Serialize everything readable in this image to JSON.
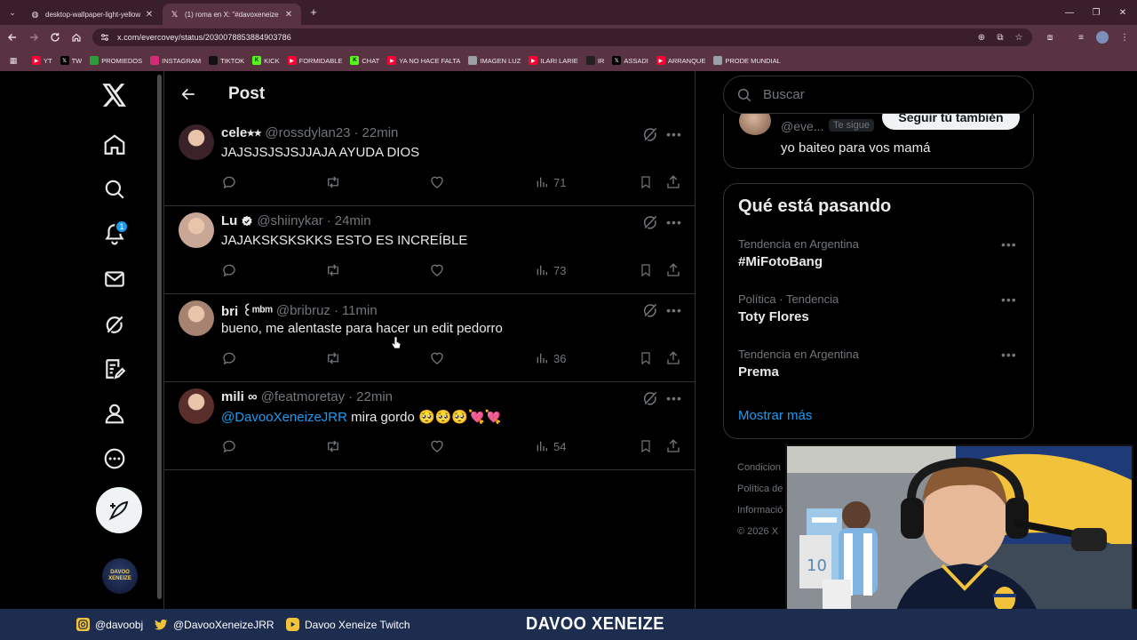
{
  "browser": {
    "tabs": [
      {
        "title": "desktop-wallpaper-light-yellow",
        "active": false
      },
      {
        "title": "(1) roma en X: \"#davoxeneize",
        "active": true
      }
    ],
    "url": "x.com/evercovey/status/2030078853884903786",
    "bookmarks": [
      {
        "label": "YT",
        "icon": "youtube-icon",
        "color": "#ff0033"
      },
      {
        "label": "TW",
        "icon": "x-icon",
        "color": "#000000"
      },
      {
        "label": "PROMIEDOS",
        "icon": "promiedos-icon",
        "color": "#2e9b3a"
      },
      {
        "label": "INSTAGRAM",
        "icon": "instagram-icon",
        "color": "#d62976"
      },
      {
        "label": "TIKTOK",
        "icon": "tiktok-icon",
        "color": "#111111"
      },
      {
        "label": "KICK",
        "icon": "kick-icon",
        "color": "#53fc18"
      },
      {
        "label": "FORMIDABLE",
        "icon": "youtube-icon",
        "color": "#ff0033"
      },
      {
        "label": "CHAT",
        "icon": "kick-icon",
        "color": "#53fc18"
      },
      {
        "label": "YA NO HACE FALTA",
        "icon": "youtube-icon",
        "color": "#ff0033"
      },
      {
        "label": "IMAGEN LUZ",
        "icon": "globe-icon",
        "color": "#9aa0a6"
      },
      {
        "label": "ILARI LARIE",
        "icon": "youtube-icon",
        "color": "#ff0033"
      },
      {
        "label": "IR",
        "icon": "mk-icon",
        "color": "#222222"
      },
      {
        "label": "ASSADI",
        "icon": "x-icon",
        "color": "#000000"
      },
      {
        "label": "ARRANQUE",
        "icon": "youtube-icon",
        "color": "#ff0033"
      },
      {
        "label": "PRODE MUNDIAL",
        "icon": "globe-icon",
        "color": "#9aa0a6"
      }
    ]
  },
  "header": {
    "title": "Post"
  },
  "nav": {
    "notification_count": "1"
  },
  "replies": [
    {
      "name": "cele⭑⭒",
      "handle": "@rossdylan23",
      "time": "22min",
      "text": "JAJSJSJSJSJJAJA AYUDA DIOS",
      "mention": "",
      "views": "71",
      "verified": false,
      "avatar_color": "#3a2228"
    },
    {
      "name": "Lu",
      "handle": "@shiinykar",
      "time": "24min",
      "text": "JAJAKSKSKSKKS ESTO ES INCREÍBLE",
      "mention": "",
      "views": "73",
      "verified": true,
      "avatar_color": "#c9a796"
    },
    {
      "name": "bri ꒰ᵐᵇᵐ",
      "handle": "@bribruz",
      "time": "11min",
      "text": "bueno, me alentaste para hacer un edit pedorro",
      "mention": "",
      "views": "36",
      "verified": false,
      "avatar_color": "#a58370"
    },
    {
      "name": "mili ∞",
      "handle": "@featmoretay",
      "time": "22min",
      "text": " mira gordo 🥺🥺🥺💘💘",
      "mention": "@DavooXeneizeJRR",
      "views": "54",
      "verified": false,
      "avatar_color": "#5a2f2b"
    }
  ],
  "sidebar": {
    "search_placeholder": "Buscar",
    "who_to_follow": {
      "handle": "@eve...",
      "badge": "Te sigue",
      "button": "Seguir tú también",
      "bio": "yo baiteo para vos mamá"
    },
    "trends_title": "Qué está pasando",
    "trends": [
      {
        "context": "Tendencia en Argentina",
        "name": "#MiFotoBang"
      },
      {
        "context": "Política · Tendencia",
        "name": "Toty Flores"
      },
      {
        "context": "Tendencia en Argentina",
        "name": "Prema"
      }
    ],
    "show_more": "Mostrar más",
    "footer": [
      "Condicion",
      "Política de",
      "Informació",
      "© 2026 X"
    ]
  },
  "stream": {
    "instagram": "@davoobj",
    "twitter": "@DavooXeneizeJRR",
    "twitch": "Davoo Xeneize Twitch",
    "brand": "DAVOO XENEIZE"
  },
  "colors": {
    "accent": "#1d9bf0",
    "browser_frame": "#5a3343",
    "stream_bar": "#1d2d4f"
  }
}
